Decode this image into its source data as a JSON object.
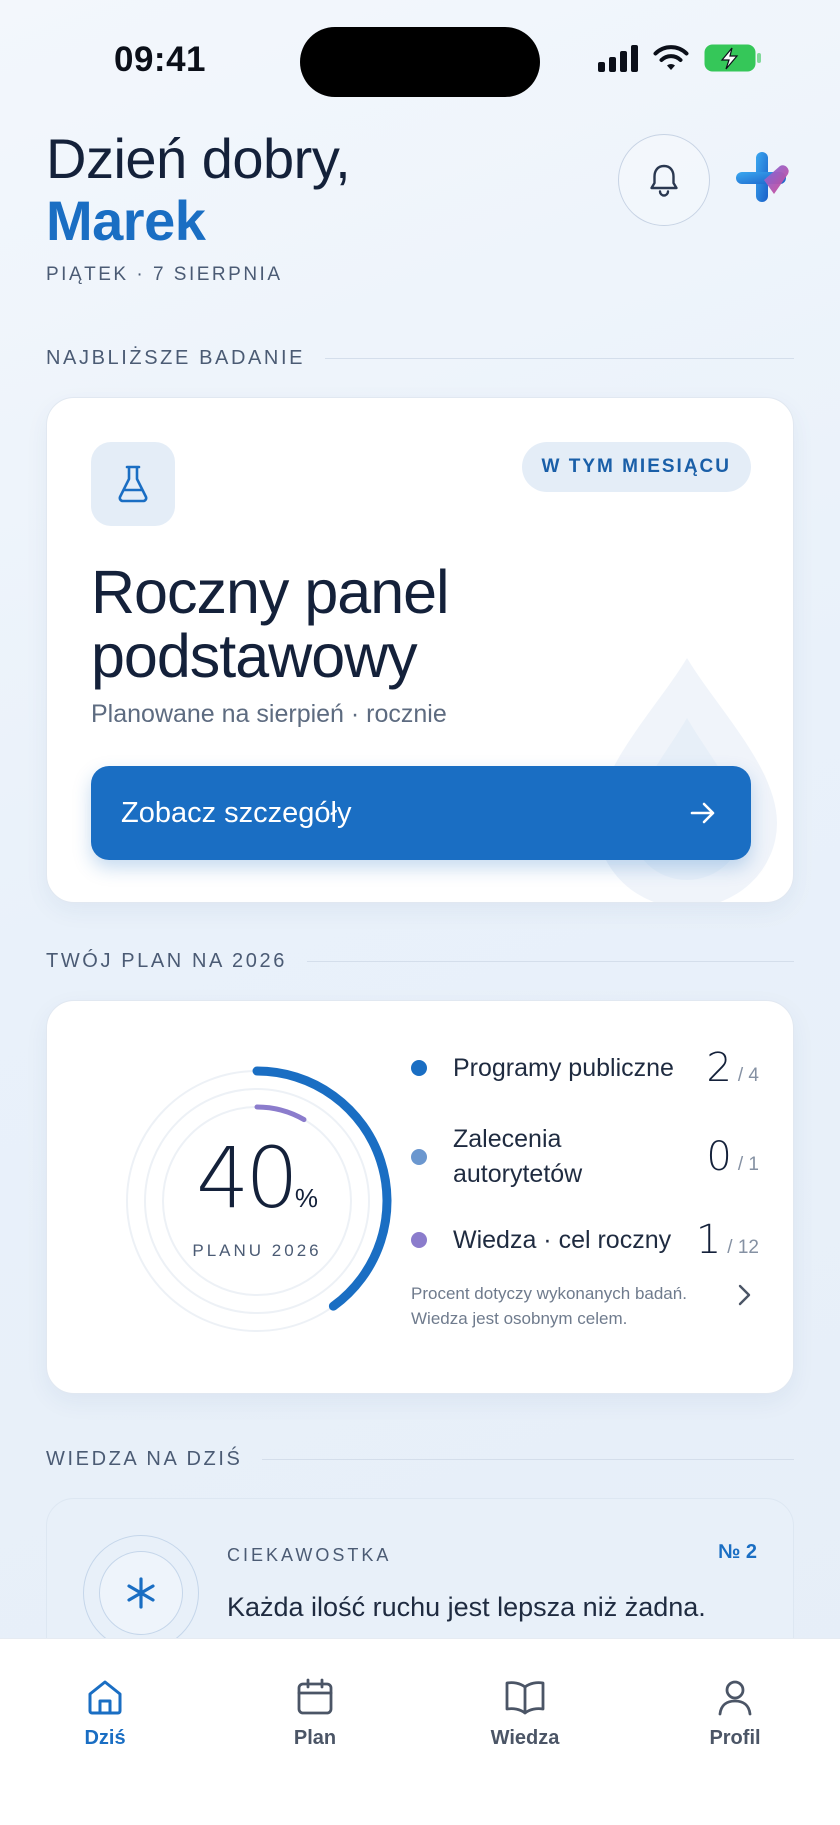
{
  "status": {
    "time": "09:41"
  },
  "header": {
    "greeting": "Dzień dobry,",
    "name": "Marek",
    "date": "PIĄTEK · 7 SIERPNIA"
  },
  "next_exam": {
    "section_title": "NAJBLIŻSZE BADANIE",
    "badge": "W TYM MIESIĄCU",
    "title_line1": "Roczny panel",
    "title_line2": "podstawowy",
    "subtitle": "Planowane na sierpień · rocznie",
    "cta_label": "Zobacz szczegóły"
  },
  "plan": {
    "section_title": "TWÓJ PLAN NA 2026",
    "percent": 40,
    "percent_text": "40",
    "percent_sign": "%",
    "percent_label": "PLANU 2026",
    "knowledge_fraction": 0.0833,
    "items": [
      {
        "label": "Programy publiczne",
        "value": "2",
        "total": "/ 4",
        "color": "#1a6ec3"
      },
      {
        "label": "Zalecenia autorytetów",
        "value": "0",
        "total": "/ 1",
        "color": "#6b97cf"
      },
      {
        "label": "Wiedza · cel roczny",
        "value": "1",
        "total": "/ 12",
        "color": "#8b7ccc"
      }
    ],
    "note": "Procent dotyczy wykonanych badań. Wiedza jest osobnym celem."
  },
  "knowledge": {
    "section_title": "WIEDZA NA DZIŚ",
    "kind": "CIEKAWOSTKA",
    "number": "№ 2",
    "text": "Każda ilość ruchu jest lepsza niż żadna."
  },
  "nav": [
    {
      "label": "Dziś",
      "icon": "home-icon",
      "active": true
    },
    {
      "label": "Plan",
      "icon": "calendar-icon",
      "active": false
    },
    {
      "label": "Wiedza",
      "icon": "book-icon",
      "active": false
    },
    {
      "label": "Profil",
      "icon": "user-icon",
      "active": false
    }
  ],
  "colors": {
    "accent": "#1a6ec3",
    "text": "#14213a",
    "muted": "#4b5b74"
  }
}
